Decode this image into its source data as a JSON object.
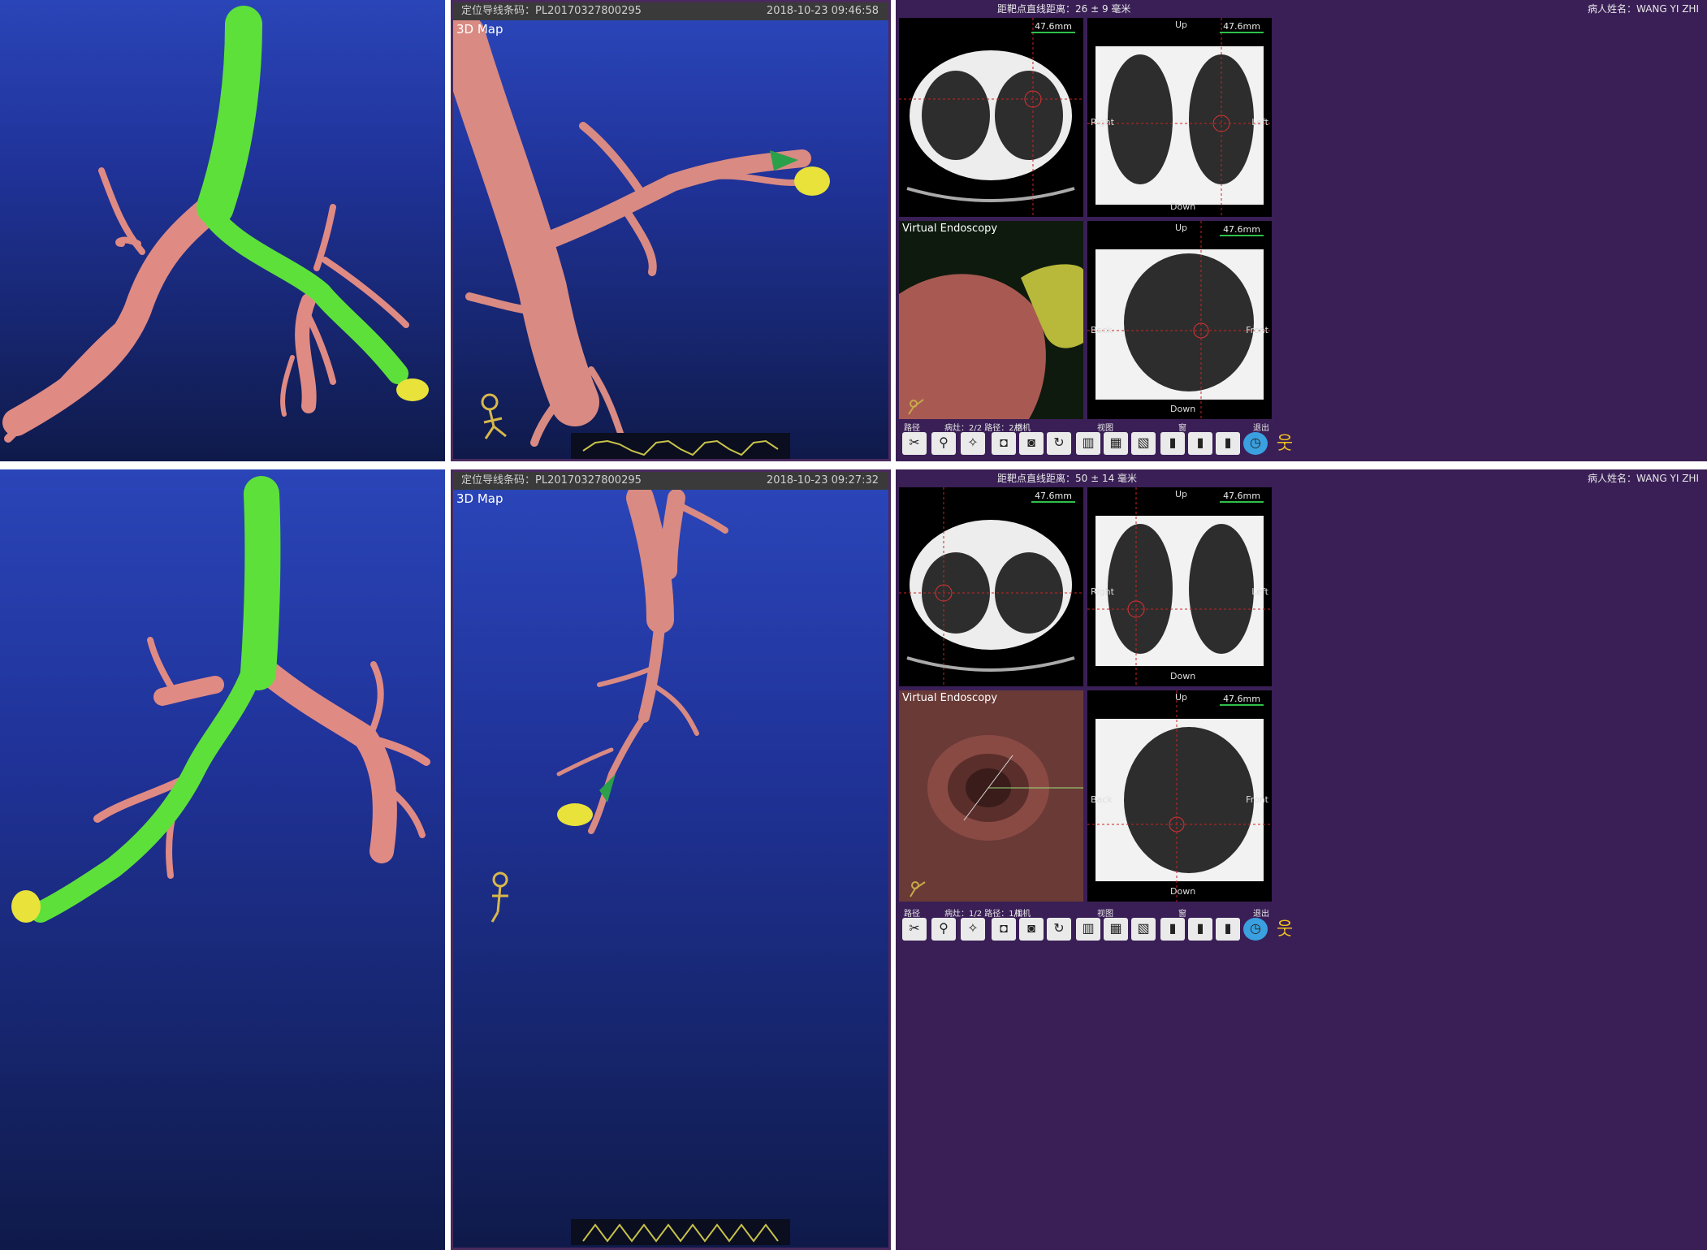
{
  "top_row": {
    "viewer": {
      "barcode": "定位导线条码：PL20170327800295",
      "timestamp": "2018-10-23 09:46:58",
      "view_label": "3D Map"
    },
    "ct": {
      "distance": "距靶点直线距离：26 ± 9 毫米",
      "patient": "病人姓名：WANG YI ZHI",
      "scale": "47.6mm",
      "up": "Up",
      "down": "Down",
      "right": "Right",
      "left": "Left",
      "back": "Back",
      "front": "Front",
      "ve_label": "Virtual Endoscopy",
      "toolbar": {
        "g1": "路径",
        "g2": "病灶：2/2  路径：2/2",
        "g3": "相机",
        "g4": "视图",
        "g5": "窗",
        "g6": "退出"
      }
    }
  },
  "bottom_row": {
    "viewer": {
      "barcode": "定位导线条码：PL20170327800295",
      "timestamp": "2018-10-23 09:27:32",
      "view_label": "3D Map"
    },
    "ct": {
      "distance": "距靶点直线距离：50 ± 14 毫米",
      "patient": "病人姓名：WANG YI ZHI",
      "scale": "47.6mm",
      "up": "Up",
      "down": "Down",
      "right": "Right",
      "left": "Left",
      "back": "Back",
      "front": "Front",
      "ve_label": "Virtual Endoscopy",
      "toolbar": {
        "g1": "路径",
        "g2": "病灶：1/2  路径：1/1",
        "g3": "相机",
        "g4": "视图",
        "g5": "窗",
        "g6": "退出"
      }
    }
  }
}
